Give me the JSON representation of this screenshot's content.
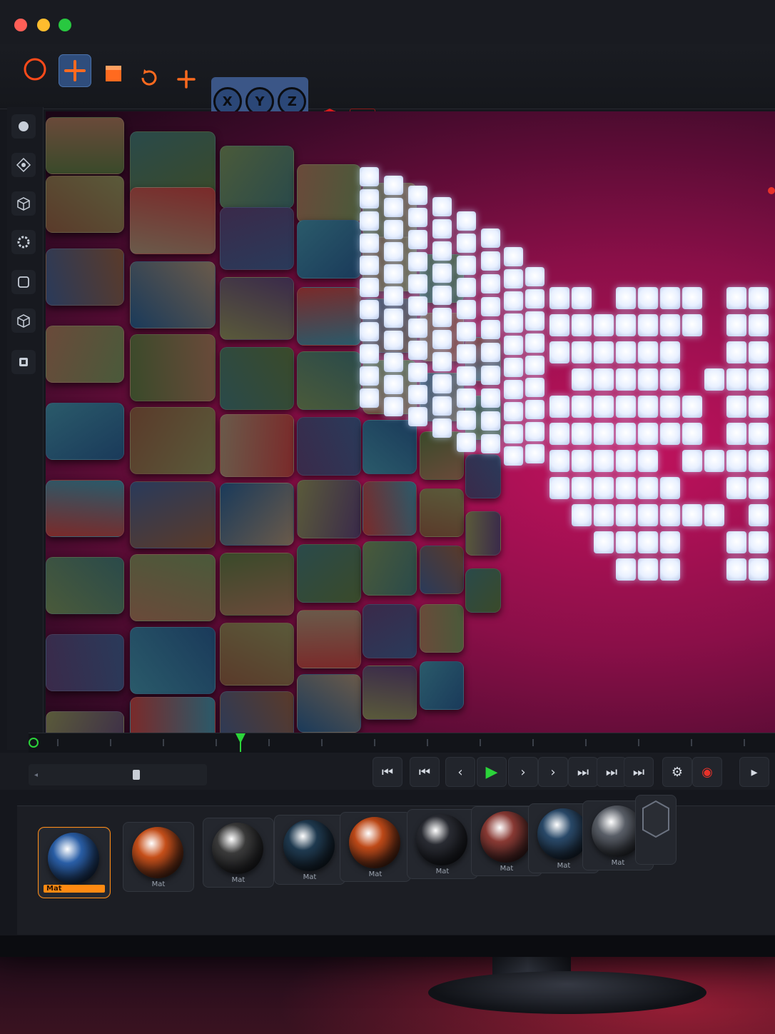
{
  "window": {
    "controls": [
      "close",
      "minimize",
      "maximize"
    ],
    "colors": {
      "close": "#ff5f57",
      "minimize": "#febc2e",
      "maximize": "#28c840"
    }
  },
  "toolbar": {
    "accent": "#ff6a1f",
    "transform_tools": [
      {
        "icon": "circle-select-icon"
      },
      {
        "icon": "move-icon",
        "active": true
      },
      {
        "icon": "cube-face-icon"
      },
      {
        "icon": "rotate-icon"
      },
      {
        "icon": "add-icon"
      }
    ],
    "axes": [
      {
        "icon": "x-axis-icon",
        "label": "X"
      },
      {
        "icon": "y-axis-icon",
        "label": "Y"
      },
      {
        "icon": "z-axis-icon",
        "label": "Z"
      }
    ],
    "object_tools": [
      "red-cube-icon",
      "dotted-selection-icon",
      "particle-emitter-icon",
      "particle-gear-icon",
      "blue-cube-icon",
      "link-icon",
      "green-cube-icon",
      "green-gear-icon",
      "blue-sphere-icon",
      "grid-plane-icon",
      "infinity-icon",
      "light-bulb-icon"
    ]
  },
  "left_rail": {
    "tools": [
      "sphere-icon",
      "transform-gizmo-icon",
      "cube-icon",
      "cog-mesh-icon",
      "square-icon",
      "box-icon",
      "layer-icon"
    ]
  },
  "viewport": {
    "background_accent": "#c2125e"
  },
  "timeline": {
    "playhead_color": "#2bd43a"
  },
  "transport": {
    "buttons": [
      "go-to-start-icon",
      "previous-key-icon",
      "step-back-icon",
      "play-icon",
      "step-forward-icon",
      "next-frame-icon",
      "next-key-icon",
      "skip-forward-icon",
      "go-to-end-icon"
    ],
    "extra": [
      "snapshot-icon",
      "record-icon",
      "camera-icon"
    ]
  },
  "materials": {
    "items": [
      {
        "label": "Mat",
        "selected": true,
        "color": "#2a5fa8"
      },
      {
        "label": "Mat",
        "color": "#c8501a"
      },
      {
        "label": "Mat",
        "color": "#3b3b3b"
      },
      {
        "label": "Mat",
        "color": "#1f3a50"
      },
      {
        "label": "Mat",
        "color": "#c04a18"
      },
      {
        "label": "Mat",
        "color": "#2a2c33"
      },
      {
        "label": "Mat",
        "color": "#8a3a34"
      },
      {
        "label": "Mat",
        "color": "#2a4a6a"
      },
      {
        "label": "Mat",
        "color": "#5a5f68"
      }
    ]
  }
}
